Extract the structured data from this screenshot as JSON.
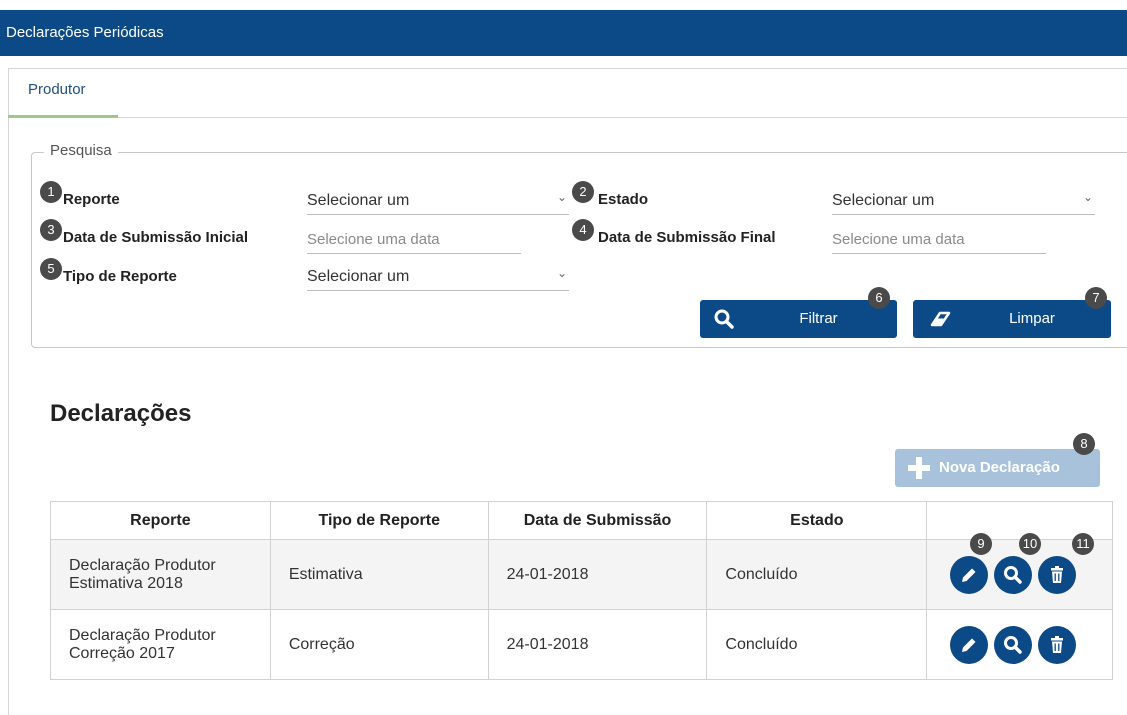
{
  "window": {
    "title": "Declarações Periódicas"
  },
  "tabs": [
    {
      "label": "Produtor",
      "active": true
    }
  ],
  "search": {
    "legend": "Pesquisa",
    "fields": {
      "reporte": {
        "label": "Reporte",
        "value": "Selecionar um"
      },
      "estado": {
        "label": "Estado",
        "value": "Selecionar um"
      },
      "data_inicial": {
        "label": "Data de Submissão Inicial",
        "placeholder": "Selecione uma data"
      },
      "data_final": {
        "label": "Data de Submissão Final",
        "placeholder": "Selecione uma data"
      },
      "tipo_reporte": {
        "label": "Tipo de Reporte",
        "value": "Selecionar um"
      }
    },
    "filter_label": "Filtrar",
    "clear_label": "Limpar"
  },
  "declarations": {
    "title": "Declarações",
    "new_label": "Nova Declaração",
    "columns": [
      "Reporte",
      "Tipo de Reporte",
      "Data de Submissão",
      "Estado"
    ],
    "rows": [
      {
        "reporte_line1": "Declaração Produtor",
        "reporte_line2": "Estimativa 2018",
        "tipo": "Estimativa",
        "data": "24-01-2018",
        "estado": "Concluído"
      },
      {
        "reporte_line1": "Declaração Produtor",
        "reporte_line2": "Correção 2017",
        "tipo": "Correção",
        "data": "24-01-2018",
        "estado": "Concluído"
      }
    ]
  },
  "markers": [
    "1",
    "2",
    "3",
    "4",
    "5",
    "6",
    "7",
    "8",
    "9",
    "10",
    "11"
  ],
  "colors": {
    "primary": "#0c4a87",
    "primary_disabled": "#a8c2dc",
    "tab_underline": "#9fc78d"
  }
}
